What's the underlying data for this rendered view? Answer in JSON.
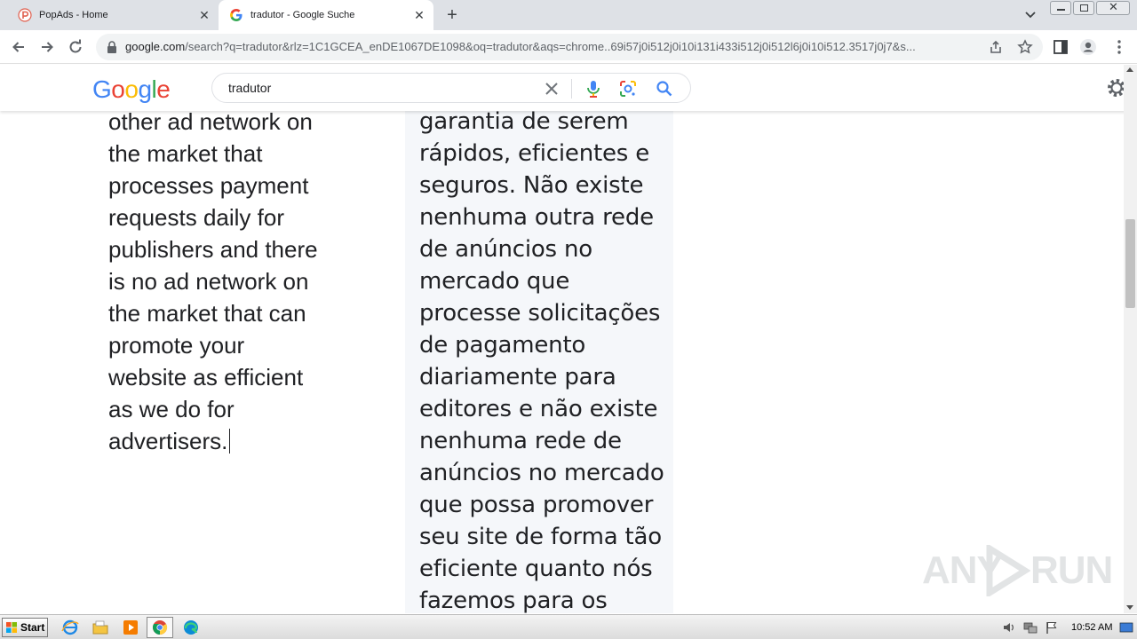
{
  "browser": {
    "tabs": [
      {
        "title": "PopAds - Home",
        "favicon": "popads-icon",
        "active": false
      },
      {
        "title": "tradutor - Google Suche",
        "favicon": "google-g-icon",
        "active": true
      }
    ],
    "url_host": "google.com",
    "url_rest": "/search?q=tradutor&rlz=1C1GCEA_enDE1067DE1098&oq=tradutor&aqs=chrome..69i57j0i512j0i10i131i433i512j0i512l6j0i10i512.3517j0j7&s..."
  },
  "google": {
    "logo_letters": [
      {
        "ch": "G",
        "color": "#4285F4"
      },
      {
        "ch": "o",
        "color": "#EA4335"
      },
      {
        "ch": "o",
        "color": "#FBBC05"
      },
      {
        "ch": "g",
        "color": "#4285F4"
      },
      {
        "ch": "l",
        "color": "#34A853"
      },
      {
        "ch": "e",
        "color": "#EA4335"
      }
    ],
    "search_query": "tradutor"
  },
  "translator": {
    "source_lines": [
      "other ad network on",
      "the market that",
      "processes payment",
      "requests daily for",
      "publishers and there",
      "is no ad network on",
      "the market that can",
      "promote your",
      "website as efficient",
      "as we do for",
      "advertisers."
    ],
    "target_lines": [
      "garantia de serem",
      "rápidos, eficientes e",
      "seguros. Não existe",
      "nenhuma outra rede",
      "de anúncios no",
      "mercado que",
      "processe solicitações",
      "de pagamento",
      "diariamente para",
      "editores e não existe",
      "nenhuma rede de",
      "anúncios no mercado",
      "que possa promover",
      "seu site de forma tão",
      "eficiente quanto nós",
      "fazemos para os"
    ]
  },
  "watermark": {
    "left": "ANY",
    "right": "RUN"
  },
  "taskbar": {
    "start_label": "Start",
    "clock": "10:52 AM"
  },
  "colors": {
    "google_blue": "#4285F4",
    "google_red": "#EA4335",
    "google_yellow": "#FBBC05",
    "google_green": "#34A853",
    "translation_panel": "#f5f7fa"
  }
}
